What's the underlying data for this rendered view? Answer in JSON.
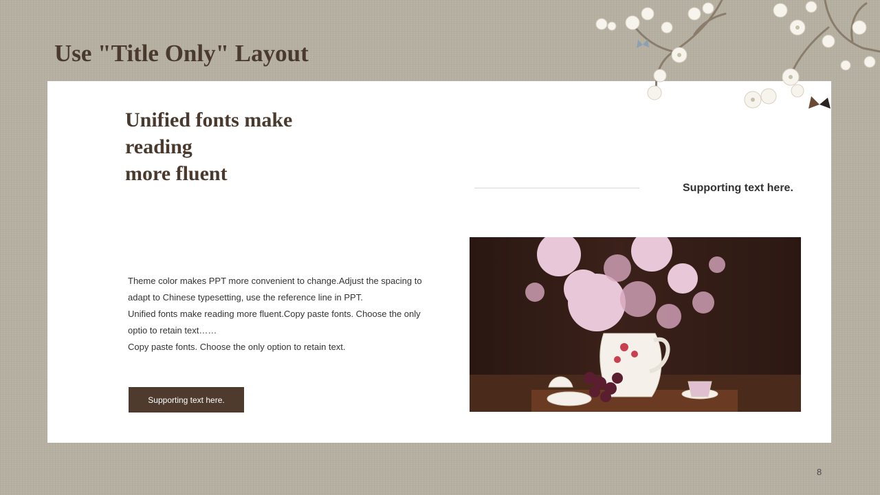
{
  "slide": {
    "title": "Use \"Title Only\" Layout",
    "page_number": "8"
  },
  "content": {
    "heading_lines": [
      "Unified fonts make",
      "reading",
      "more fluent"
    ],
    "supporting_top": "Supporting text here.",
    "body_paragraphs": [
      "Theme  color makes PPT more convenient  to change.Adjust the spacing to adapt to Chinese  typesetting, use the reference line in PPT.",
      "Unified  fonts make reading more fluent.Copy paste fonts. Choose the only optio to retain text……",
      "Copy paste  fonts. Choose the only option to retain text."
    ],
    "button_label": "Supporting text here."
  },
  "colors": {
    "background": "#b6b0a2",
    "accent_brown": "#4e3b2d",
    "title_text": "#4a3a2e"
  },
  "icons": {
    "decoration": "magnolia-branch-with-butterflies",
    "photo": "flower-vase-still-life-photo"
  }
}
